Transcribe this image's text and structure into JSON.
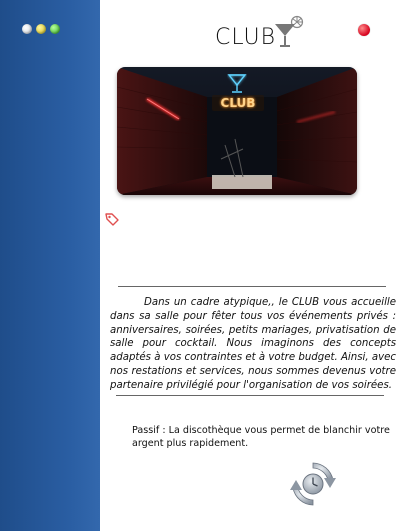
{
  "window": {
    "title": "CLUB",
    "controls": [
      "white-dot",
      "yellow-dot",
      "green-dot"
    ],
    "close_color": "#d6001c"
  },
  "image": {
    "alt": "Entrée du club avec enseigne néon",
    "neon_sign": "CLUB"
  },
  "description": "Dans un cadre atypique,, le CLUB vous accueille dans sa salle pour fêter tous vos événements privés : anniversaires, soirées, petits mariages, privatisation de salle pour cocktail. Nous imaginons des concepts adaptés à vos contraintes et à votre budget. Ainsi, avec nos restations et services, nous sommes devenus votre partenaire privilégié pour l'organisation de vos soirées.",
  "passive": "Passif : La discothèque vous permet de blanchir votre argent plus rapidement.",
  "colors": {
    "sidebar": "#2a5ea3",
    "accent": "#d6001c",
    "neon_orange": "#ffb347",
    "neon_blue": "#5fd3ff"
  },
  "icons": {
    "cocktail": "cocktail-icon",
    "tag": "tag-icon",
    "refresh": "refresh-clock-icon"
  }
}
